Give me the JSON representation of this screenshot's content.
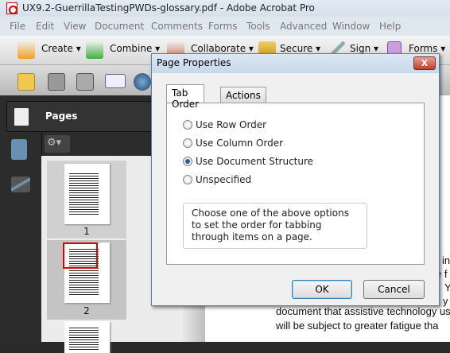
{
  "window": {
    "title": "UX9.2-GuerrillaTestingPWDs-glossary.pdf - Adobe Acrobat Pro"
  },
  "menu": [
    "File",
    "Edit",
    "View",
    "Document",
    "Comments",
    "Forms",
    "Tools",
    "Advanced",
    "Window",
    "Help"
  ],
  "toolbar": {
    "create": "Create ▾",
    "combine": "Combine ▾",
    "collaborate": "Collaborate ▾",
    "secure": "Secure ▾",
    "sign": "Sign ▾",
    "forms": "Forms ▾"
  },
  "panel": {
    "title": "Pages",
    "thumbnails": [
      {
        "page": "1"
      },
      {
        "page": "2"
      }
    ]
  },
  "document": {
    "lines": [
      "in",
      "e f",
      "Y",
      "y",
      "document that assistive technology us",
      "will be subject to greater fatigue tha"
    ]
  },
  "dialog": {
    "title": "Page Properties",
    "close": "X",
    "tabs": [
      "Tab Order",
      "Actions"
    ],
    "options": [
      {
        "label": "Use Row Order",
        "selected": false
      },
      {
        "label": "Use Column Order",
        "selected": false
      },
      {
        "label": "Use Document Structure",
        "selected": true
      },
      {
        "label": "Unspecified",
        "selected": false
      }
    ],
    "hint": "Choose one of the above options to set the order for tabbing through items on a page.",
    "ok": "OK",
    "cancel": "Cancel"
  }
}
